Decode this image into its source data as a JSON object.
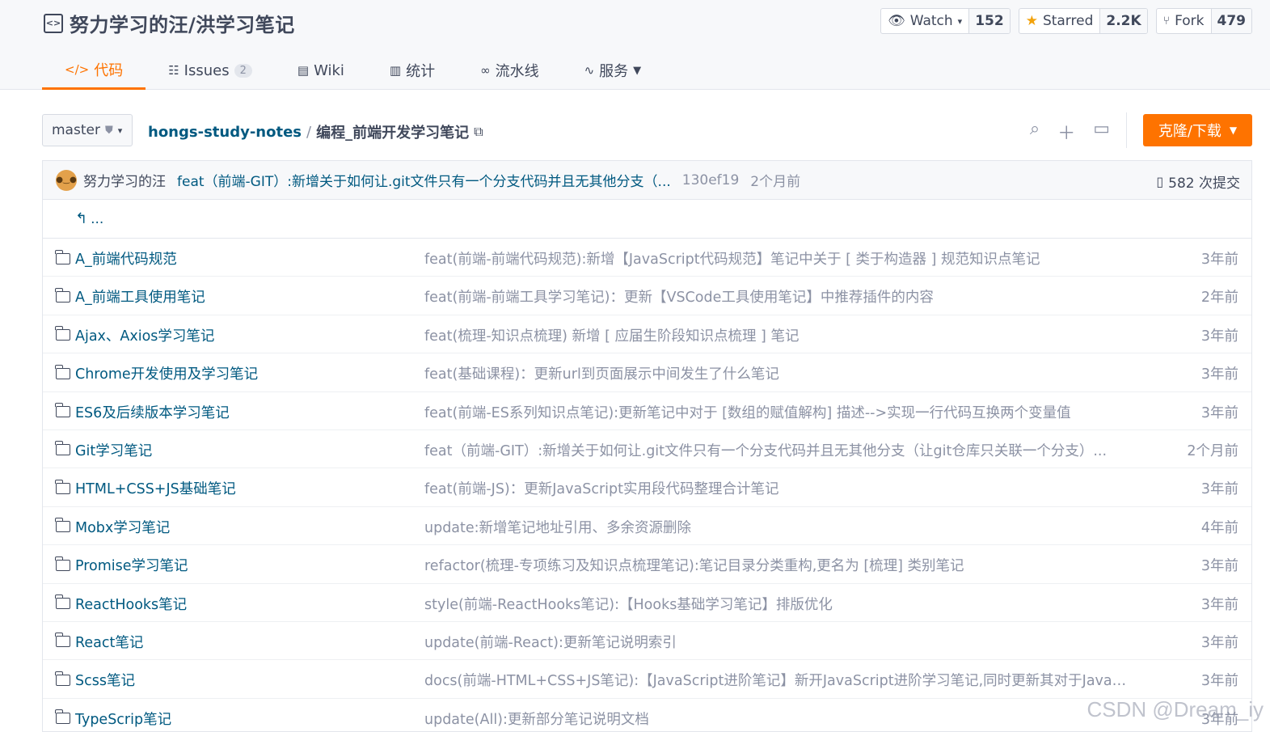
{
  "repo": {
    "title": "努力学习的汪/洪学习笔记"
  },
  "stats": {
    "watch": {
      "label": "Watch",
      "count": "152"
    },
    "star": {
      "label": "Starred",
      "count": "2.2K"
    },
    "fork": {
      "label": "Fork",
      "count": "479"
    }
  },
  "tabs": [
    {
      "label": "代码",
      "icon": "code-icon"
    },
    {
      "label": "Issues",
      "badge": "2",
      "icon": "issues-icon"
    },
    {
      "label": "Wiki",
      "icon": "wiki-icon"
    },
    {
      "label": "统计",
      "icon": "chart-icon"
    },
    {
      "label": "流水线",
      "icon": "pipeline-icon"
    },
    {
      "label": "服务",
      "icon": "pulse-icon"
    }
  ],
  "toolbar": {
    "branch": "master",
    "breadcrumb_root": "hongs-study-notes",
    "breadcrumb_sep": "/",
    "breadcrumb_current": "编程_前端开发学习笔记",
    "clone_label": "克隆/下载"
  },
  "commit": {
    "author": "努力学习的汪",
    "message": "feat（前端-GIT）:新增关于如何让.git文件只有一个分支代码并且无其他分支（...",
    "sha": "130ef19",
    "time": "2个月前",
    "commits_label": "582 次提交"
  },
  "back_label": "...",
  "files": [
    {
      "name": "A_前端代码规范",
      "message": "feat(前端-前端代码规范):新增【JavaScript代码规范】笔记中关于 [ 类于构造器 ] 规范知识点笔记",
      "time": "3年前"
    },
    {
      "name": "A_前端工具使用笔记",
      "message": "feat(前端-前端工具学习笔记)：更新【VSCode工具使用笔记】中推荐插件的内容",
      "time": "2年前"
    },
    {
      "name": "Ajax、Axios学习笔记",
      "message": "feat(梳理-知识点梳理) 新增 [ 应届生阶段知识点梳理 ] 笔记",
      "time": "3年前"
    },
    {
      "name": "Chrome开发使用及学习笔记",
      "message": "feat(基础课程)：更新url到页面展示中间发生了什么笔记",
      "time": "3年前"
    },
    {
      "name": "ES6及后续版本学习笔记",
      "message": "feat(前端-ES系列知识点笔记):更新笔记中对于 [数组的赋值解构] 描述-->实现一行代码互换两个变量值",
      "time": "3年前"
    },
    {
      "name": "Git学习笔记",
      "message": "feat（前端-GIT）:新增关于如何让.git文件只有一个分支代码并且无其他分支（让git仓库只关联一个分支）...",
      "time": "2个月前"
    },
    {
      "name": "HTML+CSS+JS基础笔记",
      "message": "feat(前端-JS)：更新JavaScript实用段代码整理合计笔记",
      "time": "3年前"
    },
    {
      "name": "Mobx学习笔记",
      "message": "update:新增笔记地址引用、多余资源删除",
      "time": "4年前"
    },
    {
      "name": "Promise学习笔记",
      "message": "refactor(梳理-专项练习及知识点梳理笔记):笔记目录分类重构,更名为 [梳理] 类别笔记",
      "time": "3年前"
    },
    {
      "name": "ReactHooks笔记",
      "message": "style(前端-ReactHooks笔记):【Hooks基础学习笔记】排版优化",
      "time": "3年前"
    },
    {
      "name": "React笔记",
      "message": "update(前端-React):更新笔记说明索引",
      "time": "3年前"
    },
    {
      "name": "Scss笔记",
      "message": "docs(前端-HTML+CSS+JS笔记):【JavaScript进阶笔记】新开JavaScript进阶学习笔记,同时更新其对于JavaS...",
      "time": "3年前"
    },
    {
      "name": "TypeScrip笔记",
      "message": "update(All):更新部分笔记说明文档",
      "time": "3年前"
    }
  ],
  "watermark": "CSDN @Dream_iy"
}
